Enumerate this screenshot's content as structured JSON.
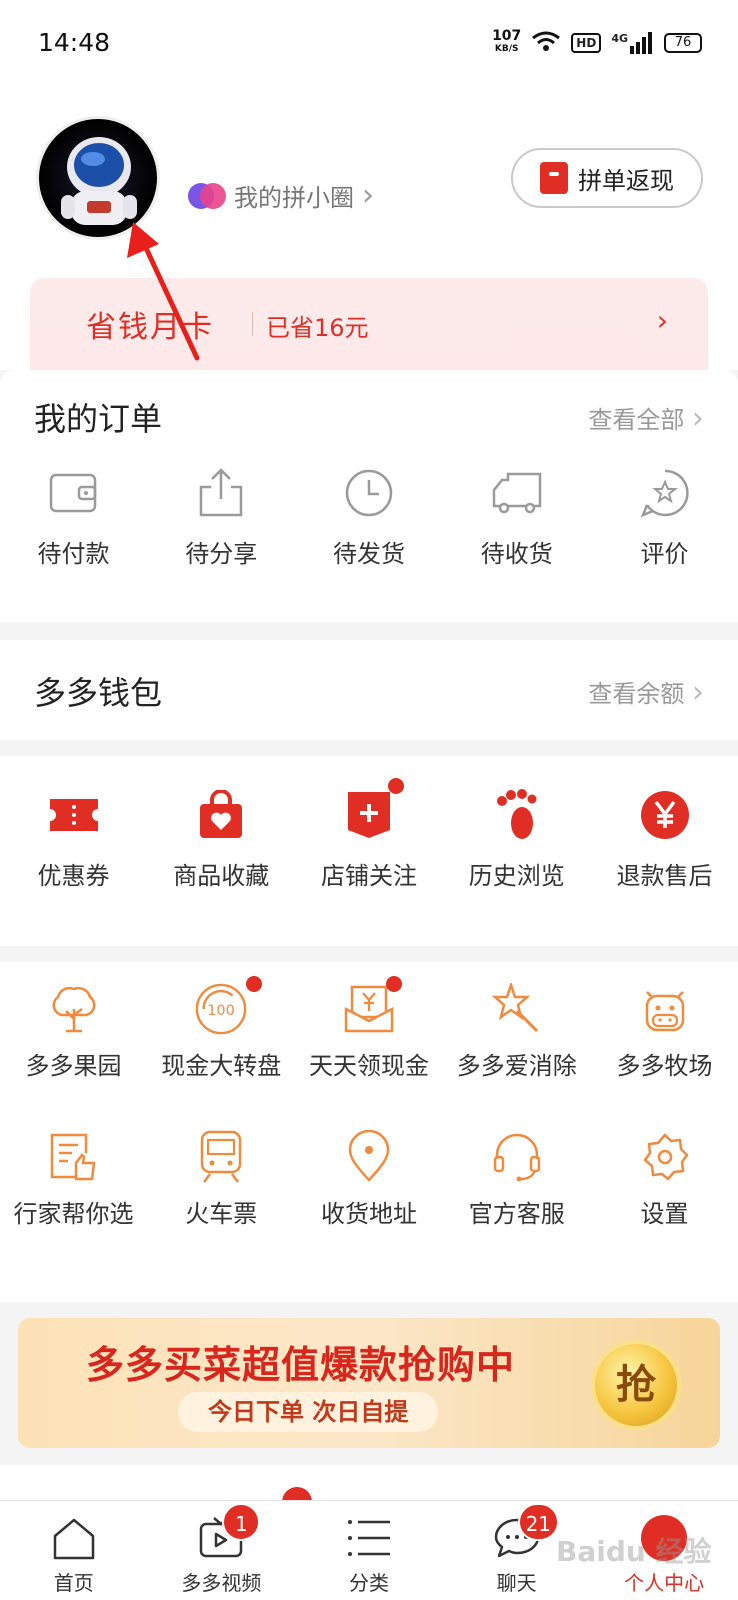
{
  "status_bar": {
    "time": "14:48",
    "net_speed": "107",
    "net_unit": "KB/S",
    "hd": "HD",
    "network": "4G",
    "battery": "76"
  },
  "header": {
    "circle_label": "我的拼小圈",
    "circle_chevron": "›",
    "cashback_label": "拼单返现"
  },
  "savings": {
    "title": "省钱月卡",
    "amount": "已省16元",
    "chevron": "›"
  },
  "orders": {
    "title": "我的订单",
    "view_all": "查看全部",
    "chevron": "›",
    "items": [
      {
        "label": "待付款",
        "icon": "wallet-icon"
      },
      {
        "label": "待分享",
        "icon": "share-icon"
      },
      {
        "label": "待发货",
        "icon": "clock-icon"
      },
      {
        "label": "待收货",
        "icon": "truck-icon"
      },
      {
        "label": "评价",
        "icon": "review-star-icon"
      }
    ]
  },
  "wallet": {
    "title": "多多钱包",
    "view_balance": "查看余额",
    "chevron": "›"
  },
  "services": {
    "items": [
      {
        "label": "优惠券",
        "icon": "coupon-icon",
        "dot": false
      },
      {
        "label": "商品收藏",
        "icon": "favorite-bag-icon",
        "dot": false
      },
      {
        "label": "店铺关注",
        "icon": "store-follow-icon",
        "dot": true
      },
      {
        "label": "历史浏览",
        "icon": "footprint-icon",
        "dot": false
      },
      {
        "label": "退款售后",
        "icon": "refund-yen-icon",
        "dot": false
      }
    ]
  },
  "tools": {
    "row1": [
      {
        "label": "多多果园",
        "icon": "tree-icon",
        "dot": false
      },
      {
        "label": "现金大转盘",
        "icon": "wheel-100-icon",
        "dot": true
      },
      {
        "label": "天天领现金",
        "icon": "cash-envelope-icon",
        "dot": true
      },
      {
        "label": "多多爱消除",
        "icon": "star-wand-icon",
        "dot": false
      },
      {
        "label": "多多牧场",
        "icon": "cow-icon",
        "dot": false
      }
    ],
    "row2": [
      {
        "label": "行家帮你选",
        "icon": "thumbs-doc-icon",
        "dot": false
      },
      {
        "label": "火车票",
        "icon": "train-icon",
        "dot": false
      },
      {
        "label": "收货地址",
        "icon": "location-pin-icon",
        "dot": false
      },
      {
        "label": "官方客服",
        "icon": "headset-icon",
        "dot": false
      },
      {
        "label": "设置",
        "icon": "gear-icon",
        "dot": false
      }
    ]
  },
  "promo": {
    "title": "多多买菜超值爆款抢购中",
    "subtitle": "今日下单 次日自提",
    "button": "抢"
  },
  "tabbar": {
    "tabs": [
      {
        "label": "首页",
        "icon": "home-icon",
        "badge": null
      },
      {
        "label": "多多视频",
        "icon": "video-icon",
        "badge": "1"
      },
      {
        "label": "分类",
        "icon": "category-list-icon",
        "badge": null
      },
      {
        "label": "聊天",
        "icon": "chat-icon",
        "badge": "21"
      },
      {
        "label": "个人中心",
        "icon": "profile-icon",
        "badge": null
      }
    ]
  },
  "watermark": "Baidu 经验",
  "colors": {
    "brand_red": "#e02e24",
    "icon_orange": "#f08a3c",
    "icon_gray": "#9a9a9a"
  }
}
